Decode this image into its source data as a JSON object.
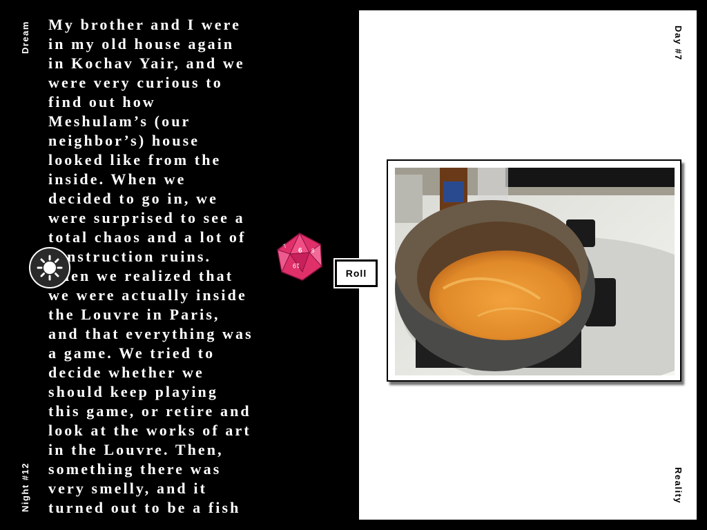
{
  "dream": {
    "label": "Dream",
    "night_label": "Night  #12",
    "text": "My brother and I were\nin my old house again\nin Kochav Yair, and we\nwere very curious to\nfind out how\nMeshulam’s (our\nneighbor’s) house\nlooked like from the\ninside. When we\ndecided to go in, we\nwere surprised to see a\ntotal chaos and a lot of\nconstruction ruins.\nThen we realized that\nwe were actually inside\nthe Louvre in Paris,\nand that everything was\na game. We tried to\ndecide whether we\nshould keep playing\nthis game, or retire and\nlook at the works of art\nin the Louvre. Then,\nsomething there was\nvery smelly, and it\nturned out to be a fish"
  },
  "reality": {
    "day_label": "Day  #7",
    "label": "Reality"
  },
  "controls": {
    "roll_label": "Roll",
    "sun_icon": "sun-icon",
    "die_icon": "d20-die-icon",
    "die_numbers": [
      "7",
      "6",
      "8",
      "19"
    ]
  },
  "colors": {
    "dream_bg": "#000000",
    "reality_bg": "#ffffff",
    "die": "#e0306a",
    "soup": "#e08a2a"
  }
}
